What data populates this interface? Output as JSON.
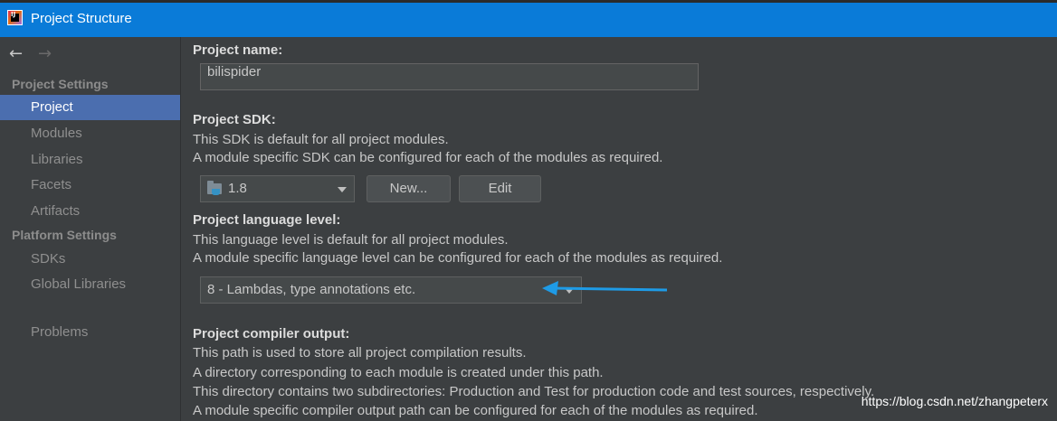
{
  "window": {
    "title": "Project Structure"
  },
  "sidebar": {
    "project_settings_header": "Project Settings",
    "project_items": [
      "Project",
      "Modules",
      "Libraries",
      "Facets",
      "Artifacts"
    ],
    "platform_settings_header": "Platform Settings",
    "platform_items": [
      "SDKs",
      "Global Libraries"
    ],
    "problems": "Problems",
    "selected": "Project"
  },
  "main": {
    "project_name_label": "Project name:",
    "project_name_value": "bilispider",
    "sdk_label": "Project SDK:",
    "sdk_desc_1": "This SDK is default for all project modules.",
    "sdk_desc_2": "A module specific SDK can be configured for each of the modules as required.",
    "sdk_value": "1.8",
    "new_button": "New...",
    "edit_button": "Edit",
    "language_label": "Project language level:",
    "language_desc_1": "This language level is default for all project modules.",
    "language_desc_2": "A module specific language level can be configured for each of the modules as required.",
    "language_value": "8 - Lambdas, type annotations etc.",
    "compiler_label": "Project compiler output:",
    "compiler_desc_1": "This path is used to store all project compilation results.",
    "compiler_desc_2": "A directory corresponding to each module is created under this path.",
    "compiler_desc_3": "This directory contains two subdirectories: Production and Test for production code and test sources, respectively.",
    "compiler_desc_4": "A module specific compiler output path can be configured for each of the modules as required."
  },
  "watermark": "https://blog.csdn.net/zhangpeterx",
  "colors": {
    "title_bar": "#0a7bd8",
    "selection": "#4b6eaf",
    "background": "#3c3f41",
    "annotation_arrow": "#1e9be6"
  },
  "icons": {
    "back": "arrow-left-icon",
    "forward": "arrow-right-icon",
    "sdk": "jdk-folder-icon",
    "dropdown": "chevron-down-icon",
    "app": "intellij-icon"
  }
}
